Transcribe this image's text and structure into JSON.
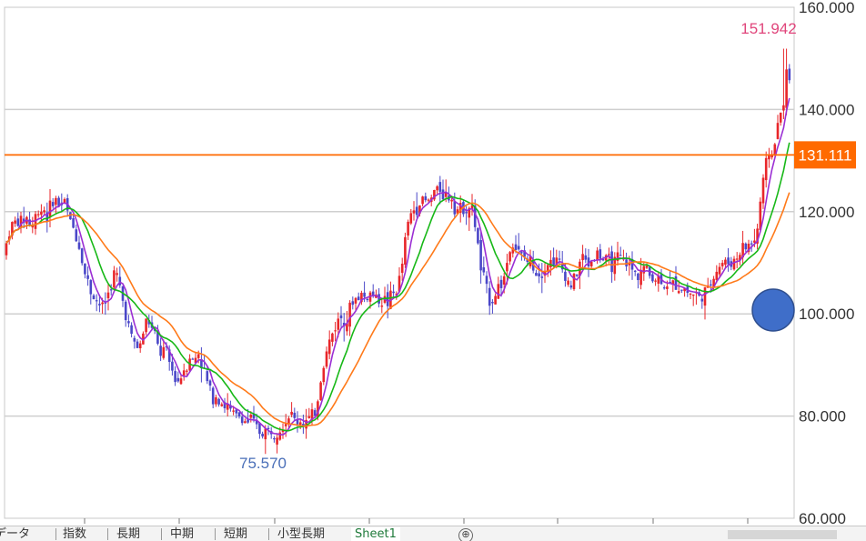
{
  "chart_data": {
    "type": "candlestick",
    "ylim": [
      60,
      160
    ],
    "y_tick_labels": [
      "160.000",
      "140.000",
      "120.000",
      "100.000",
      "80.000",
      "60.000"
    ],
    "y_ticks": [
      160,
      140,
      120,
      100,
      80,
      60
    ],
    "current_price_label": "131.111",
    "current_price": 131.111,
    "max_label": "151.942",
    "min_label": "75.570",
    "ohlc_path": [
      [
        0,
        112
      ],
      [
        6,
        117
      ],
      [
        12,
        118
      ],
      [
        18,
        118
      ],
      [
        24,
        119
      ],
      [
        30,
        117
      ],
      [
        36,
        120
      ],
      [
        42,
        121
      ],
      [
        48,
        119
      ],
      [
        54,
        123
      ],
      [
        60,
        121
      ],
      [
        66,
        122
      ],
      [
        72,
        118
      ],
      [
        78,
        116
      ],
      [
        84,
        112
      ],
      [
        88,
        108
      ],
      [
        92,
        106
      ],
      [
        96,
        104
      ],
      [
        100,
        103
      ],
      [
        104,
        102
      ],
      [
        108,
        101
      ],
      [
        112,
        103
      ],
      [
        116,
        105
      ],
      [
        120,
        108
      ],
      [
        124,
        107
      ],
      [
        128,
        104
      ],
      [
        132,
        101
      ],
      [
        136,
        98
      ],
      [
        140,
        95
      ],
      [
        144,
        94
      ],
      [
        148,
        93
      ],
      [
        152,
        96
      ],
      [
        156,
        99
      ],
      [
        160,
        98
      ],
      [
        164,
        96
      ],
      [
        168,
        94
      ],
      [
        172,
        92
      ],
      [
        176,
        93
      ],
      [
        180,
        91
      ],
      [
        184,
        89
      ],
      [
        188,
        87
      ],
      [
        192,
        87
      ],
      [
        196,
        89
      ],
      [
        200,
        90
      ],
      [
        204,
        92
      ],
      [
        208,
        90
      ],
      [
        212,
        93
      ],
      [
        216,
        91
      ],
      [
        220,
        88
      ],
      [
        224,
        86
      ],
      [
        228,
        84
      ],
      [
        232,
        84
      ],
      [
        236,
        84
      ],
      [
        240,
        82
      ],
      [
        244,
        82
      ],
      [
        248,
        81
      ],
      [
        252,
        80
      ],
      [
        256,
        80
      ],
      [
        260,
        80
      ],
      [
        264,
        79
      ],
      [
        268,
        79
      ],
      [
        272,
        79
      ],
      [
        276,
        78
      ],
      [
        280,
        77
      ],
      [
        284,
        77
      ],
      [
        288,
        77
      ],
      [
        292,
        77
      ],
      [
        296,
        77
      ],
      [
        300,
        78
      ],
      [
        304,
        78
      ],
      [
        308,
        79
      ],
      [
        312,
        80
      ],
      [
        316,
        80
      ],
      [
        320,
        79
      ],
      [
        324,
        79
      ],
      [
        328,
        79
      ],
      [
        332,
        79
      ],
      [
        336,
        79
      ],
      [
        340,
        80
      ],
      [
        344,
        83
      ],
      [
        348,
        88
      ],
      [
        352,
        91
      ],
      [
        356,
        94
      ],
      [
        360,
        96
      ],
      [
        364,
        98
      ],
      [
        368,
        99
      ],
      [
        372,
        100
      ],
      [
        376,
        99
      ],
      [
        380,
        101
      ],
      [
        384,
        103
      ],
      [
        388,
        103
      ],
      [
        392,
        104
      ],
      [
        396,
        103
      ],
      [
        400,
        104
      ],
      [
        404,
        104
      ],
      [
        408,
        103
      ],
      [
        412,
        103
      ],
      [
        416,
        103
      ],
      [
        420,
        102
      ],
      [
        424,
        103
      ],
      [
        428,
        104
      ],
      [
        432,
        105
      ],
      [
        436,
        108
      ],
      [
        440,
        114
      ],
      [
        444,
        118
      ],
      [
        448,
        120
      ],
      [
        452,
        121
      ],
      [
        456,
        122
      ],
      [
        460,
        122
      ],
      [
        464,
        122
      ],
      [
        468,
        122
      ],
      [
        472,
        124
      ],
      [
        476,
        124
      ],
      [
        480,
        125
      ],
      [
        484,
        123
      ],
      [
        488,
        123
      ],
      [
        492,
        123
      ],
      [
        496,
        121
      ],
      [
        500,
        120
      ],
      [
        504,
        121
      ],
      [
        508,
        121
      ],
      [
        512,
        121
      ],
      [
        516,
        119
      ],
      [
        520,
        114
      ],
      [
        524,
        108
      ],
      [
        528,
        106
      ],
      [
        532,
        103
      ],
      [
        536,
        103
      ],
      [
        540,
        104
      ],
      [
        544,
        106
      ],
      [
        548,
        106
      ],
      [
        552,
        110
      ],
      [
        556,
        113
      ],
      [
        560,
        114
      ],
      [
        564,
        112
      ],
      [
        568,
        111
      ],
      [
        572,
        111
      ],
      [
        576,
        110
      ],
      [
        580,
        110
      ],
      [
        584,
        109
      ],
      [
        588,
        108
      ],
      [
        592,
        109
      ],
      [
        596,
        110
      ],
      [
        600,
        110
      ],
      [
        604,
        111
      ],
      [
        608,
        110
      ],
      [
        612,
        109
      ],
      [
        616,
        108
      ],
      [
        620,
        106
      ],
      [
        624,
        106
      ],
      [
        628,
        107
      ],
      [
        632,
        110
      ],
      [
        636,
        111
      ],
      [
        640,
        110
      ],
      [
        644,
        110
      ],
      [
        648,
        111
      ],
      [
        652,
        112
      ],
      [
        656,
        111
      ],
      [
        660,
        110
      ],
      [
        664,
        110
      ],
      [
        668,
        110
      ],
      [
        672,
        110
      ],
      [
        676,
        111
      ],
      [
        680,
        110
      ],
      [
        684,
        110
      ],
      [
        688,
        109
      ],
      [
        692,
        108
      ],
      [
        696,
        108
      ],
      [
        700,
        109
      ],
      [
        704,
        109
      ],
      [
        708,
        108
      ],
      [
        712,
        107
      ],
      [
        716,
        107
      ],
      [
        720,
        107
      ],
      [
        724,
        106
      ],
      [
        728,
        106
      ],
      [
        732,
        105
      ],
      [
        736,
        106
      ],
      [
        740,
        106
      ],
      [
        744,
        105
      ],
      [
        748,
        105
      ],
      [
        752,
        104
      ],
      [
        756,
        104
      ],
      [
        760,
        104
      ],
      [
        764,
        103
      ],
      [
        768,
        104
      ],
      [
        772,
        104
      ],
      [
        776,
        106
      ],
      [
        780,
        108
      ],
      [
        784,
        109
      ],
      [
        788,
        110
      ],
      [
        792,
        110
      ],
      [
        796,
        110
      ],
      [
        800,
        110
      ],
      [
        804,
        111
      ],
      [
        808,
        112
      ],
      [
        812,
        113
      ],
      [
        816,
        113
      ],
      [
        820,
        114
      ],
      [
        824,
        114
      ],
      [
        828,
        117
      ],
      [
        832,
        124
      ],
      [
        836,
        128
      ],
      [
        840,
        132
      ],
      [
        844,
        131
      ],
      [
        848,
        135
      ],
      [
        852,
        138
      ],
      [
        856,
        142
      ],
      [
        860,
        147
      ],
      [
        864,
        146
      ],
      [
        866,
        143
      ],
      [
        870,
        134
      ]
    ]
  },
  "tabs": {
    "items": [
      "データ",
      "指数",
      "長期",
      "中期",
      "短期",
      "小型長期"
    ],
    "active": "Sheet1",
    "add_symbol": "⊕"
  },
  "colors": {
    "up": "#e8262a",
    "down": "#4a47c8",
    "ma_fast": "#9b2fd4",
    "ma_mid": "#17b817",
    "ma_slow": "#ff7a1a",
    "price_line": "#ff6a00",
    "price_box": "#ff6a00",
    "max_label": "#e0457b",
    "min_label": "#4a6fb8",
    "marker": "#3f6ec9",
    "grid": "#cfcfcf"
  }
}
